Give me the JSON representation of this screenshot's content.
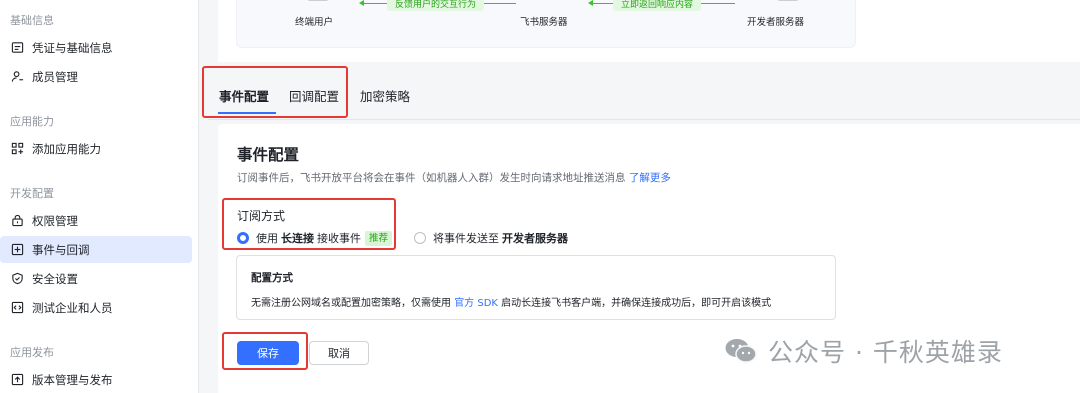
{
  "sidebar": {
    "sections": [
      {
        "label": "基础信息",
        "items": [
          {
            "label": "凭证与基础信息",
            "icon": "credential-icon"
          },
          {
            "label": "成员管理",
            "icon": "user-add-icon"
          }
        ]
      },
      {
        "label": "应用能力",
        "items": [
          {
            "label": "添加应用能力",
            "icon": "grid-add-icon"
          }
        ]
      },
      {
        "label": "开发配置",
        "items": [
          {
            "label": "权限管理",
            "icon": "lock-icon"
          },
          {
            "label": "事件与回调",
            "icon": "event-icon",
            "active": true
          },
          {
            "label": "安全设置",
            "icon": "shield-icon"
          },
          {
            "label": "测试企业和人员",
            "icon": "code-icon"
          }
        ]
      },
      {
        "label": "应用发布",
        "items": [
          {
            "label": "版本管理与发布",
            "icon": "upload-icon"
          }
        ]
      }
    ]
  },
  "flow": {
    "nodes": [
      "终端用户",
      "飞书服务器",
      "开发者服务器"
    ],
    "arrows": [
      "反馈用户的交互行为",
      "立即返回响应内容"
    ]
  },
  "tabs": [
    {
      "label": "事件配置",
      "active": true
    },
    {
      "label": "回调配置",
      "active": false
    },
    {
      "label": "加密策略",
      "active": false
    }
  ],
  "panel": {
    "title": "事件配置",
    "description": "订阅事件后，飞书开放平台将会在事件（如机器人入群）发生时向请求地址推送消息",
    "learn_more": "了解更多",
    "subscribe_label": "订阅方式",
    "option1": {
      "prefix": "使用",
      "strong": "长连接",
      "suffix": "接收事件",
      "tag": "推荐",
      "checked": true
    },
    "option2": {
      "prefix": "将事件发送至",
      "strong": "开发者服务器",
      "checked": false
    },
    "config": {
      "title": "配置方式",
      "text_before": "无需注册公网域名或配置加密策略，仅需使用",
      "link": "官方 SDK",
      "text_after": "启动长连接飞书客户端，并确保连接成功后，即可开启该模式"
    },
    "save_label": "保存",
    "cancel_label": "取消"
  },
  "watermark": {
    "text": "公众号 · 千秋英雄录"
  },
  "colors": {
    "primary": "#3370ff",
    "annotation": "#e53935",
    "tag_green": "#25a415"
  }
}
